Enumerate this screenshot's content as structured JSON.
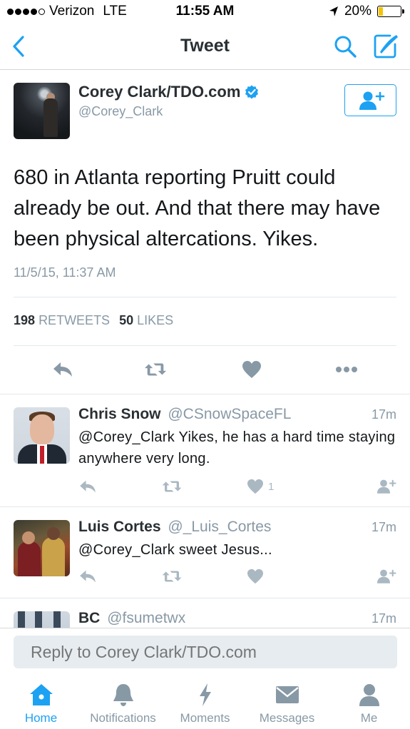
{
  "status_bar": {
    "carrier": "Verizon",
    "network": "LTE",
    "time": "11:55 AM",
    "battery": "20%",
    "battery_level": 0.2,
    "signal_bars": 4,
    "signal_max": 5
  },
  "nav": {
    "title": "Tweet",
    "back_icon": "chevron-left-icon",
    "search_icon": "search-icon",
    "compose_icon": "compose-icon"
  },
  "tweet": {
    "author_name": "Corey Clark/TDO.com",
    "author_handle": "@Corey_Clark",
    "verified": true,
    "text": "680 in Atlanta reporting Pruitt could already be out. And that there may have been physical altercations. Yikes.",
    "timestamp": "11/5/15, 11:37 AM",
    "retweets_count": "198",
    "retweets_label": "RETWEETS",
    "likes_count": "50",
    "likes_label": "LIKES"
  },
  "replies": [
    {
      "name": "Chris Snow",
      "handle": "@CSnowSpaceFL",
      "time": "17m",
      "text": "@Corey_Clark Yikes, he has a hard time staying anywhere very long.",
      "likes": "1"
    },
    {
      "name": "Luis Cortes",
      "handle": "@_Luis_Cortes",
      "time": "17m",
      "text": "@Corey_Clark sweet Jesus...",
      "likes": ""
    },
    {
      "name": "BC",
      "handle": "@fsumetwx",
      "time": "17m",
      "text": "",
      "likes": ""
    }
  ],
  "reply_box": {
    "placeholder": "Reply to Corey Clark/TDO.com"
  },
  "tabs": [
    {
      "label": "Home",
      "icon": "home-icon",
      "active": true
    },
    {
      "label": "Notifications",
      "icon": "bell-icon",
      "active": false
    },
    {
      "label": "Moments",
      "icon": "lightning-icon",
      "active": false
    },
    {
      "label": "Messages",
      "icon": "envelope-icon",
      "active": false
    },
    {
      "label": "Me",
      "icon": "person-icon",
      "active": false
    }
  ],
  "colors": {
    "accent": "#1da1f2",
    "muted": "#8899a6",
    "action_icon": "#aab8c2"
  }
}
